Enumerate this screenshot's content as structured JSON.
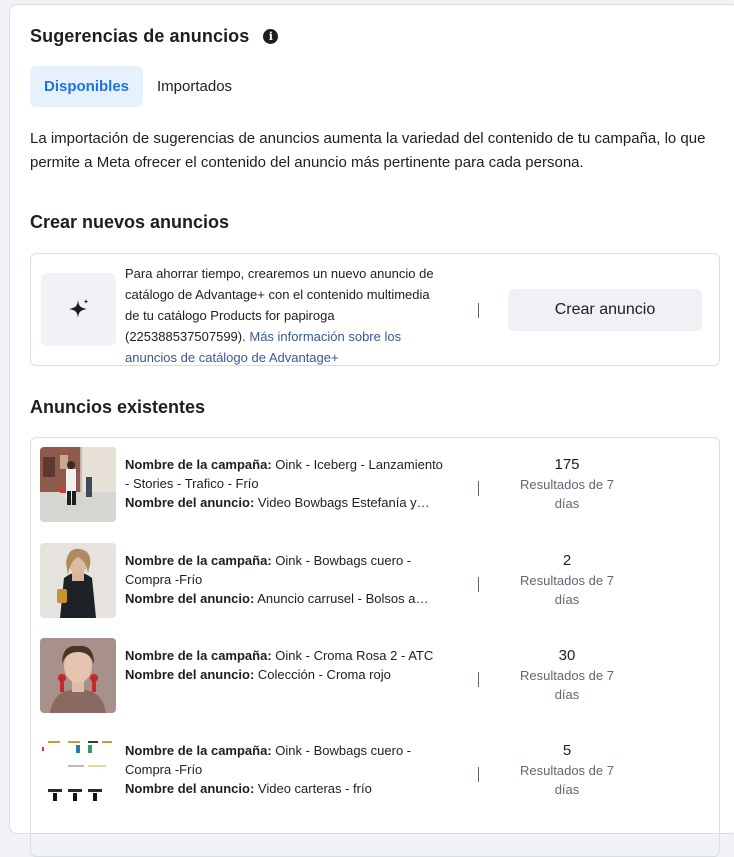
{
  "header": {
    "title": "Sugerencias de anuncios",
    "info_icon": "info-icon"
  },
  "tabs": [
    {
      "label": "Disponibles",
      "active": true
    },
    {
      "label": "Importados",
      "active": false
    }
  ],
  "description": "La importación de sugerencias de anuncios aumenta la variedad del contenido de tu campaña, lo que permite a Meta ofrecer el contenido del anuncio más pertinente para cada persona.",
  "create_section": {
    "title": "Crear nuevos anuncios",
    "icon": "sparkle-icon",
    "text": "Para ahorrar tiempo, crearemos un nuevo anuncio de catálogo de Advantage+ con el contenido multimedia de tu catálogo Products for papiroga (225388537507599).",
    "link": "Más información sobre los anuncios de catálogo de Advantage+",
    "button": "Crear anuncio"
  },
  "existing_section": {
    "title": "Anuncios existentes",
    "campaign_label": "Nombre de la campaña:",
    "ad_label": "Nombre del anuncio:",
    "results_label": "Resultados de 7 días",
    "ads": [
      {
        "campaign": "Oink - Iceberg - Lanzamiento - Stories - Trafico - Frío",
        "ad": "Video Bowbags Estefanía y…",
        "results": "175"
      },
      {
        "campaign": "Oink - Bowbags cuero - Compra -Frío",
        "ad": "Anuncio carrusel - Bolsos a…",
        "results": "2"
      },
      {
        "campaign": "Oink - Croma Rosa 2 - ATC",
        "ad": "Colección - Croma rojo",
        "results": "30"
      },
      {
        "campaign": "Oink - Bowbags cuero - Compra -Frío",
        "ad": "Video carteras - frío",
        "results": "5"
      }
    ]
  },
  "colors": {
    "accent": "#1b74e4",
    "tab_active_bg": "#e7f0fd",
    "link": "#385898",
    "button_bg": "#eff1f4"
  }
}
